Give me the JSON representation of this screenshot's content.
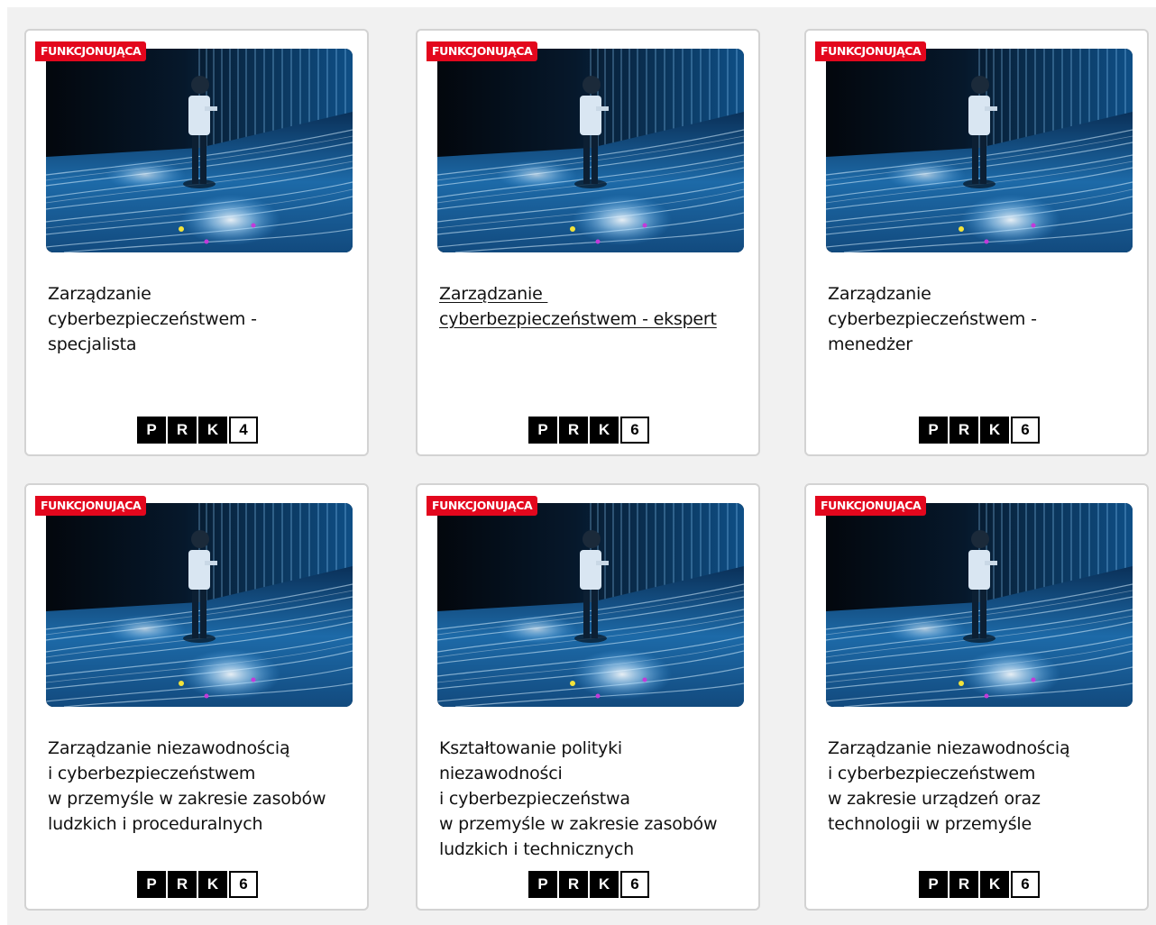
{
  "colors": {
    "badge": "#e3071d",
    "page_background": "#f1f1f1",
    "card_border": "#d3d3d3"
  },
  "image_icon": "interactive-light-floor-photo",
  "cards": [
    {
      "badge": "FUNKCJONUJĄCA",
      "title_lines": [
        "Zarządzanie",
        "cyberbezpieczeństwem -",
        "specjalista"
      ],
      "prk": {
        "letters": [
          "P",
          "R",
          "K"
        ],
        "level": "4"
      }
    },
    {
      "badge": "FUNKCJONUJĄCA",
      "title_lines": [
        "Zarządzanie ",
        "cyberbezpieczeństwem - ekspert"
      ],
      "prk": {
        "letters": [
          "P",
          "R",
          "K"
        ],
        "level": "6"
      }
    },
    {
      "badge": "FUNKCJONUJĄCA",
      "title_lines": [
        "Zarządzanie",
        "cyberbezpieczeństwem -",
        "menedżer"
      ],
      "prk": {
        "letters": [
          "P",
          "R",
          "K"
        ],
        "level": "6"
      }
    },
    {
      "badge": "FUNKCJONUJĄCA",
      "title_lines": [
        "Zarządzanie niezawodnością",
        "i cyberbezpieczeństwem",
        "w przemyśle w zakresie zasobów",
        "ludzkich i proceduralnych"
      ],
      "prk": {
        "letters": [
          "P",
          "R",
          "K"
        ],
        "level": "6"
      }
    },
    {
      "badge": "FUNKCJONUJĄCA",
      "title_lines": [
        "Kształtowanie polityki",
        "niezawodności",
        "i cyberbezpieczeństwa",
        "w przemyśle w zakresie zasobów",
        "ludzkich i technicznych"
      ],
      "prk": {
        "letters": [
          "P",
          "R",
          "K"
        ],
        "level": "6"
      }
    },
    {
      "badge": "FUNKCJONUJĄCA",
      "title_lines": [
        "Zarządzanie niezawodnością",
        "i cyberbezpieczeństwem",
        "w zakresie urządzeń oraz",
        "technologii w przemyśle"
      ],
      "prk": {
        "letters": [
          "P",
          "R",
          "K"
        ],
        "level": "6"
      }
    }
  ]
}
